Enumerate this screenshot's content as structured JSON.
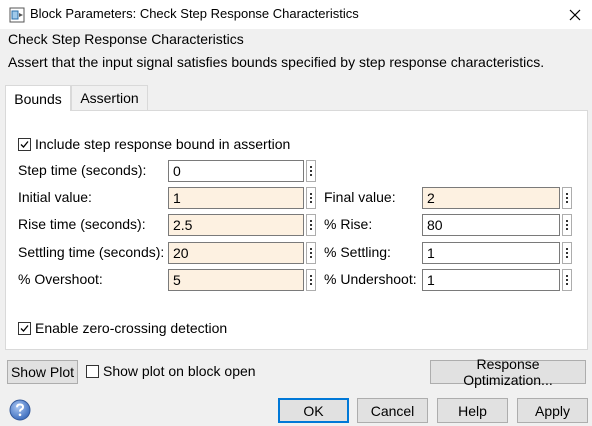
{
  "window": {
    "title": "Block Parameters: Check Step Response Characteristics"
  },
  "header": {
    "block_name": "Check Step Response Characteristics",
    "description": "Assert that the input signal satisfies bounds specified by step response characteristics."
  },
  "tabs": [
    {
      "label": "Bounds",
      "active": true
    },
    {
      "label": "Assertion",
      "active": false
    }
  ],
  "bounds": {
    "include_bound_label": "Include step response bound in assertion",
    "include_bound_checked": true,
    "step_time": {
      "label": "Step time (seconds):",
      "value": "0"
    },
    "initial_value": {
      "label": "Initial value:",
      "value": "1"
    },
    "final_value": {
      "label": "Final value:",
      "value": "2"
    },
    "rise_time": {
      "label": "Rise time (seconds):",
      "value": "2.5"
    },
    "percent_rise": {
      "label": "% Rise:",
      "value": "80"
    },
    "settling_time": {
      "label": "Settling time (seconds):",
      "value": "20"
    },
    "percent_settling": {
      "label": "% Settling:",
      "value": "1"
    },
    "percent_overshoot": {
      "label": "% Overshoot:",
      "value": "5"
    },
    "percent_undershoot": {
      "label": "% Undershoot:",
      "value": "1"
    },
    "zero_crossing_label": "Enable zero-crossing detection",
    "zero_crossing_checked": true
  },
  "plot": {
    "show_plot_label": "Show Plot",
    "show_on_open_label": "Show plot on block open",
    "show_on_open_checked": false,
    "response_optimization_label": "Response Optimization..."
  },
  "footer": {
    "ok_label": "OK",
    "cancel_label": "Cancel",
    "help_label": "Help",
    "apply_label": "Apply"
  },
  "colors": {
    "highlight_field": "#fdf1e1",
    "accent": "#0078d7",
    "panel_bg": "#ffffff",
    "window_bg": "#f0f0f0"
  },
  "icons": {
    "app": "simulink-block-icon",
    "close": "close-icon",
    "checkmark": "checkmark-icon",
    "more": "vertical-dots-icon",
    "help": "help-question-icon"
  }
}
